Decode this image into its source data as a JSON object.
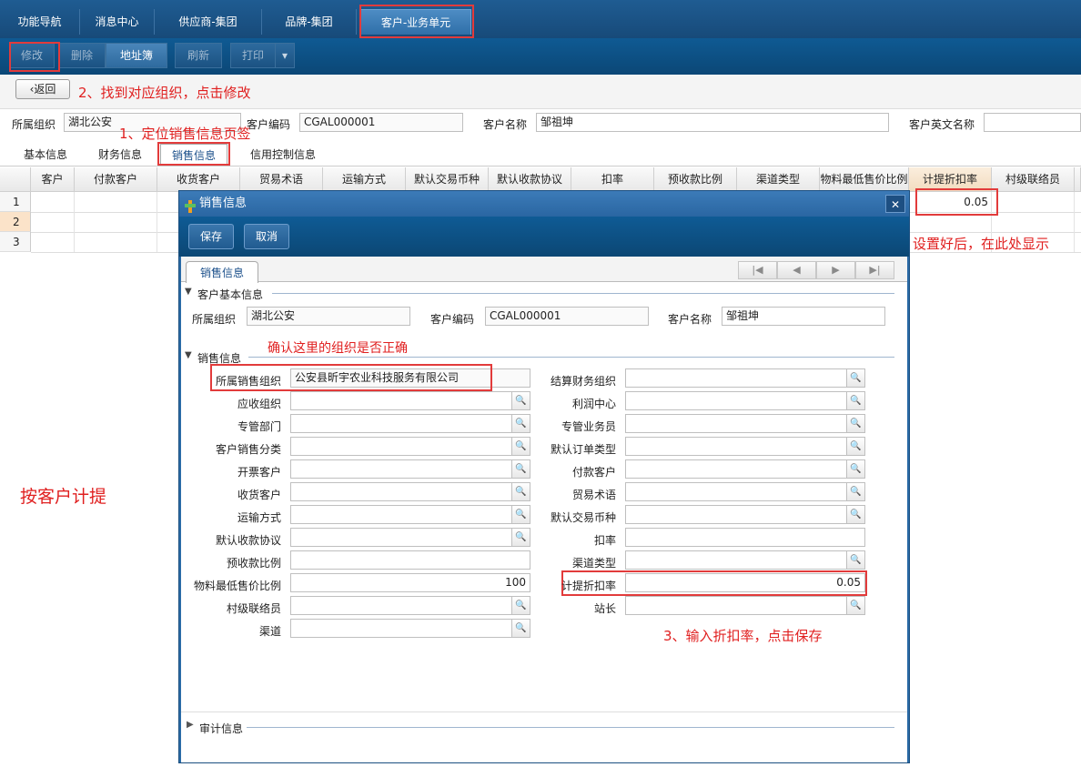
{
  "topnav": {
    "tabs": [
      "功能导航",
      "消息中心",
      "供应商-集团",
      "品牌-集团",
      "客户-业务单元"
    ]
  },
  "toolbar": {
    "edit": "修改",
    "delete": "删除",
    "address": "地址簿",
    "refresh": "刷新",
    "print": "打印"
  },
  "back": {
    "label": "返回"
  },
  "header": {
    "org_label": "所属组织",
    "org_value": "湖北公安",
    "code_label": "客户编码",
    "code_value": "CGAL000001",
    "name_label": "客户名称",
    "name_value": "邹祖坤",
    "en_label": "客户英文名称"
  },
  "subtabs": [
    "基本信息",
    "财务信息",
    "销售信息",
    "信用控制信息"
  ],
  "grid": {
    "columns": [
      "客户",
      "付款客户",
      "收货客户",
      "贸易术语",
      "运输方式",
      "默认交易币种",
      "默认收款协议",
      "扣率",
      "预收款比例",
      "渠道类型",
      "物料最低售价比例",
      "计提折扣率",
      "村级联络员"
    ],
    "rows": [
      "1",
      "2",
      "3"
    ],
    "row1_rate": "0.05"
  },
  "dialog": {
    "title": "销售信息",
    "save": "保存",
    "cancel": "取消",
    "tab": "销售信息",
    "sec_basic": "客户基本信息",
    "basic": {
      "org_label": "所属组织",
      "org_value": "湖北公安",
      "code_label": "客户编码",
      "code_value": "CGAL000001",
      "name_label": "客户名称",
      "name_value": "邹祖坤"
    },
    "sec_sales": "销售信息",
    "sales_org_label": "所属销售组织",
    "sales_org_value": "公安县昕宇农业科技服务有限公司",
    "left_labels": [
      "应收组织",
      "专管部门",
      "客户销售分类",
      "开票客户",
      "收货客户",
      "运输方式",
      "默认收款协议",
      "预收款比例",
      "物料最低售价比例",
      "村级联络员",
      "渠道"
    ],
    "right_labels": [
      "结算财务组织",
      "利润中心",
      "专管业务员",
      "默认订单类型",
      "付款客户",
      "贸易术语",
      "默认交易币种",
      "扣率",
      "渠道类型",
      "计提折扣率",
      "站长"
    ],
    "min_price_ratio": "100",
    "rate_value": "0.05",
    "sec_audit": "审计信息"
  },
  "annotations": {
    "a1": "1、定位销售信息页签",
    "a2": "2、找到对应组织，点击修改",
    "a3": "3、输入折扣率，点击保存",
    "a_confirm": "确认这里的组织是否正确",
    "a_shown": "设置好后，在此处显示",
    "a_side": "按客户计提"
  }
}
